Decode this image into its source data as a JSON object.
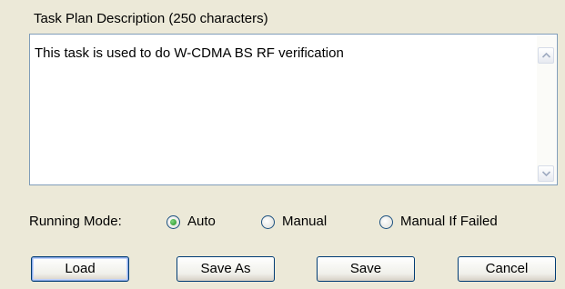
{
  "description": {
    "title": "Task Plan Description (250 characters)",
    "text": "This task is used to do W-CDMA BS RF verification"
  },
  "running_mode": {
    "label": "Running Mode:",
    "options": [
      {
        "label": "Auto",
        "selected": true
      },
      {
        "label": "Manual",
        "selected": false
      },
      {
        "label": "Manual If Failed",
        "selected": false
      }
    ]
  },
  "buttons": {
    "load": "Load",
    "save_as": "Save As",
    "save": "Save",
    "cancel": "Cancel"
  },
  "colors": {
    "background": "#ece9d8",
    "textbox_border": "#7f9db9",
    "radio_selected": "#1f8f1f"
  }
}
